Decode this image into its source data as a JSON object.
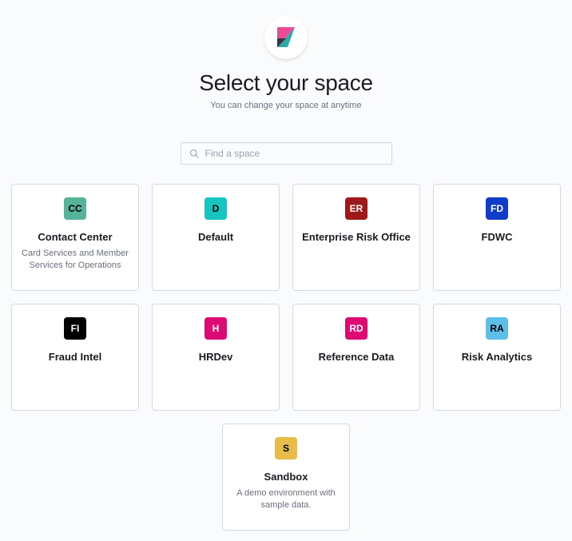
{
  "header": {
    "title": "Select your space",
    "subtitle": "You can change your space at anytime"
  },
  "search": {
    "placeholder": "Find a space"
  },
  "spaces": [
    {
      "initials": "CC",
      "bg": "#54b399",
      "fg": "#000000",
      "name": "Contact Center",
      "desc": "Card Services and Member Services for Operations"
    },
    {
      "initials": "D",
      "bg": "#16c5c0",
      "fg": "#000000",
      "name": "Default",
      "desc": ""
    },
    {
      "initials": "ER",
      "bg": "#9e1a1a",
      "fg": "#ffffff",
      "name": "Enterprise Risk Office",
      "desc": ""
    },
    {
      "initials": "FD",
      "bg": "#0f3cc9",
      "fg": "#ffffff",
      "name": "FDWC",
      "desc": ""
    },
    {
      "initials": "FI",
      "bg": "#000000",
      "fg": "#ffffff",
      "name": "Fraud Intel",
      "desc": ""
    },
    {
      "initials": "H",
      "bg": "#dd0a73",
      "fg": "#ffffff",
      "name": "HRDev",
      "desc": ""
    },
    {
      "initials": "RD",
      "bg": "#dd0a73",
      "fg": "#ffffff",
      "name": "Reference Data",
      "desc": ""
    },
    {
      "initials": "RA",
      "bg": "#5bbfea",
      "fg": "#000000",
      "name": "Risk Analytics",
      "desc": ""
    },
    {
      "initials": "S",
      "bg": "#e7bd4a",
      "fg": "#000000",
      "name": "Sandbox",
      "desc": "A demo environment with sample data."
    }
  ]
}
